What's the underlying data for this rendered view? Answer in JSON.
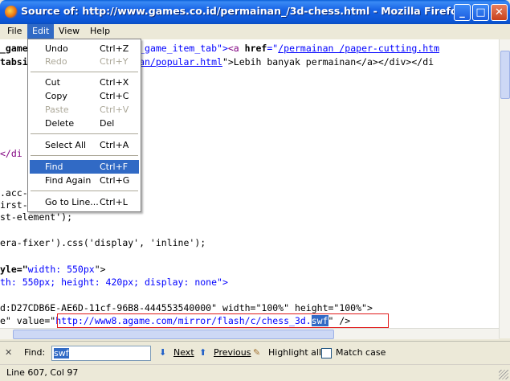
{
  "window": {
    "title": "Source of: http://www.games.co.id/permainan_/3d-chess.html - Mozilla Firefox",
    "buttons": {
      "minimize": "_",
      "maximize": "□",
      "close": "✕"
    }
  },
  "menubar": {
    "file": "File",
    "edit": "Edit",
    "view": "View",
    "help": "Help"
  },
  "edit_menu": [
    {
      "label": "Undo",
      "shortcut": "Ctrl+Z",
      "disabled": false
    },
    {
      "label": "Redo",
      "shortcut": "Ctrl+Y",
      "disabled": true
    },
    {
      "label": "Cut",
      "shortcut": "Ctrl+X",
      "disabled": false
    },
    {
      "label": "Copy",
      "shortcut": "Ctrl+C",
      "disabled": false
    },
    {
      "label": "Paste",
      "shortcut": "Ctrl+V",
      "disabled": true
    },
    {
      "label": "Delete",
      "shortcut": "Del",
      "disabled": false
    },
    {
      "label": "Select All",
      "shortcut": "Ctrl+A",
      "disabled": false
    },
    {
      "label": "Find",
      "shortcut": "Ctrl+F",
      "disabled": false,
      "highlighted": true
    },
    {
      "label": "Find Again",
      "shortcut": "Ctrl+G",
      "disabled": false
    },
    {
      "label": "Go to Line...",
      "shortcut": "Ctrl+L",
      "disabled": false
    }
  ],
  "source": {
    "l1_a": "_game",
    "l1_b": "ar_game_item_tab\">",
    "l1_c": "<a ",
    "l1_d": "href",
    "l1_e": "=\"",
    "l1_f": "/permainan /paper-cutting.htm",
    "l2_a": "tabsi",
    "l2_b": "inan/popular.html",
    "l2_c": "\">Lebih banyak permainan</a></div></di",
    "l3": "</di",
    "l4": ".acc-",
    "l5": "irst-",
    "l6": "st-element');",
    "l7": "era-fixer').css('display', 'inline');",
    "l8_a": "yle=\"",
    "l8_b": "width: 550px",
    "l8_c": "\">",
    "l9": "th: 550px; height: 420px; display: none\">",
    "l10": "d:D27CDB6E-AE6D-11cf-96B8-444553540000\" width=\"100%\" height=\"100%\">",
    "l11_a": "e\" value=\"",
    "l11_b": "http://www8.agame.com/mirror/flash/c/chess_3d.",
    "l11_c": "swf",
    "l11_d": "\" />"
  },
  "findbar": {
    "close": "✕",
    "label": "Find:",
    "query": "swf",
    "next": "Next",
    "previous": "Previous",
    "highlight_all": "Highlight all",
    "match_case": "Match case"
  },
  "status": {
    "text": "Line 607, Col 97"
  }
}
